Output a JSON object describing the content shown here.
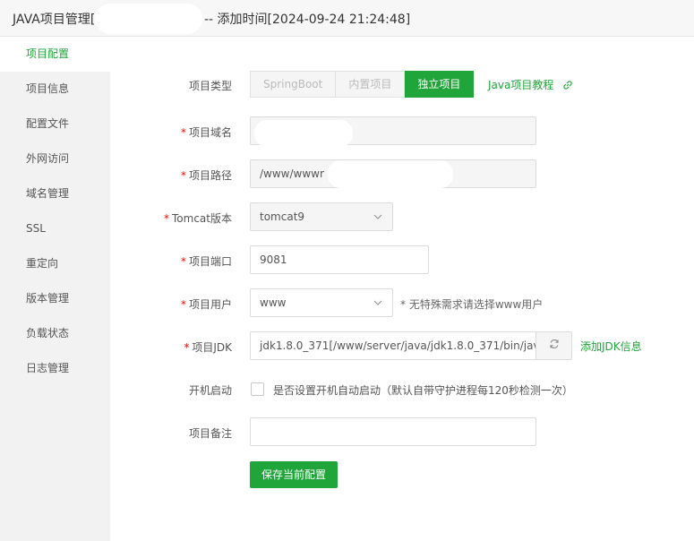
{
  "title": {
    "prefix": "JAVA项目管理[",
    "suffix": "-- 添加时间[2024-09-24 21:24:48]"
  },
  "sidebar": {
    "items": [
      {
        "label": "项目配置",
        "active": true
      },
      {
        "label": "项目信息"
      },
      {
        "label": "配置文件"
      },
      {
        "label": "外网访问"
      },
      {
        "label": "域名管理"
      },
      {
        "label": "SSL"
      },
      {
        "label": "重定向"
      },
      {
        "label": "版本管理"
      },
      {
        "label": "负载状态"
      },
      {
        "label": "日志管理"
      }
    ]
  },
  "form": {
    "required_mark": "*",
    "project_type": {
      "label": "项目类型",
      "options": [
        "SpringBoot",
        "内置项目",
        "独立项目"
      ],
      "selected": "独立项目",
      "tutorial_link": "Java项目教程"
    },
    "domain": {
      "label": "项目域名",
      "value": ""
    },
    "path": {
      "label": "项目路径",
      "value": "/www/wwwr"
    },
    "tomcat": {
      "label": "Tomcat版本",
      "value": "tomcat9"
    },
    "port": {
      "label": "项目端口",
      "value": "9081"
    },
    "user": {
      "label": "项目用户",
      "value": "www",
      "hint": "* 无特殊需求请选择www用户"
    },
    "jdk": {
      "label": "项目JDK",
      "value": "jdk1.8.0_371[/www/server/java/jdk1.8.0_371/bin/jav",
      "add_link": "添加JDK信息"
    },
    "autostart": {
      "label": "开机启动",
      "checkbox_label": "是否设置开机自动启动（默认自带守护进程每120秒检测一次）",
      "checked": false
    },
    "remark": {
      "label": "项目备注",
      "value": ""
    },
    "save_button": "保存当前配置"
  },
  "colors": {
    "accent": "#20a53a",
    "required": "#ef0808"
  }
}
